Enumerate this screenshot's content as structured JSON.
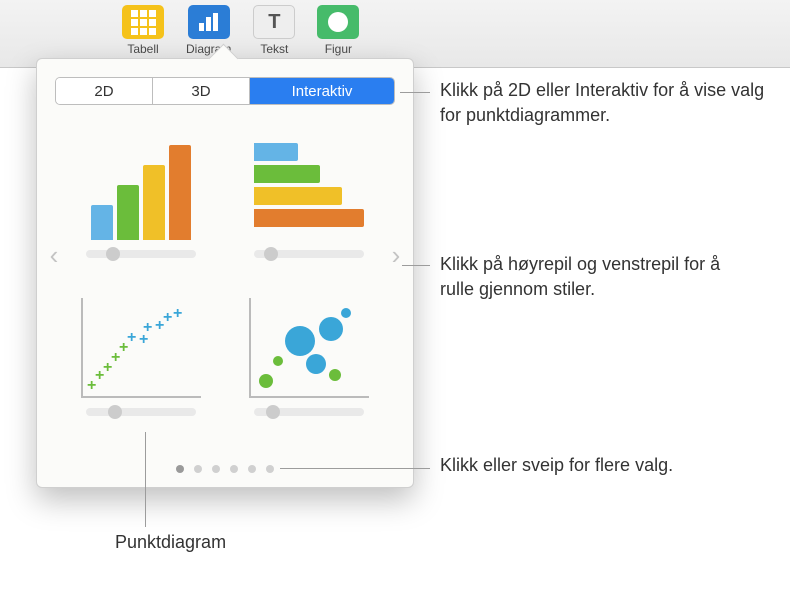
{
  "toolbar": {
    "tabell": "Tabell",
    "diagram": "Diagram",
    "tekst": "Tekst",
    "figur": "Figur",
    "tekst_icon_letter": "T"
  },
  "segmented": {
    "d2": "2D",
    "d3": "3D",
    "interaktiv": "Interaktiv"
  },
  "callouts": {
    "tabs": "Klikk på 2D eller Interaktiv for å vise valg for punktdiagrammer.",
    "arrows": "Klikk på høyrepil og venstrepil for å rulle gjennom stiler.",
    "dots": "Klikk eller sveip for flere valg.",
    "punkt": "Punktdiagram"
  }
}
